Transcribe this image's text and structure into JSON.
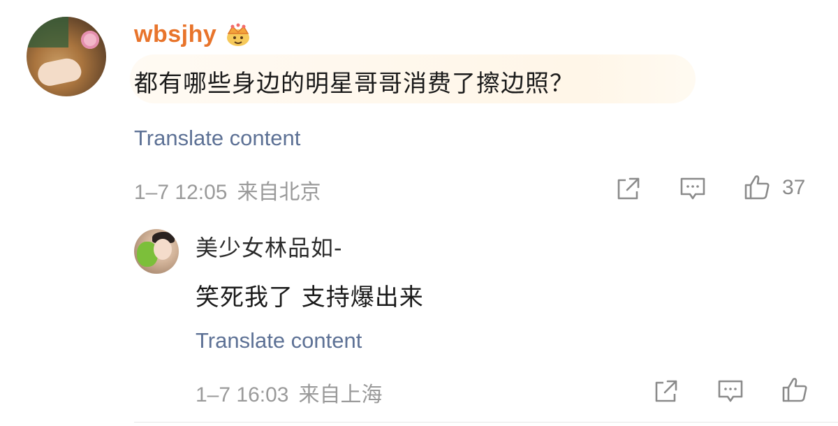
{
  "comment": {
    "username": "wbsjhy",
    "text": "都有哪些身边的明星哥哥消费了擦边照？",
    "translate_label": "Translate content",
    "date": "1–7 12:05",
    "location": "来自北京",
    "likes": "37",
    "colors": {
      "username": "#e8742b",
      "translate": "#5d7195",
      "meta": "#9a9a9a"
    },
    "icons": [
      "crown-badge-icon",
      "share-icon",
      "reply-icon",
      "like-icon"
    ]
  },
  "reply": {
    "username": "美少女林品如-",
    "text": "笑死我了 支持爆出来",
    "translate_label": "Translate content",
    "date": "1–7 16:03",
    "location": "来自上海",
    "icons": [
      "share-icon",
      "reply-icon",
      "like-icon"
    ]
  }
}
